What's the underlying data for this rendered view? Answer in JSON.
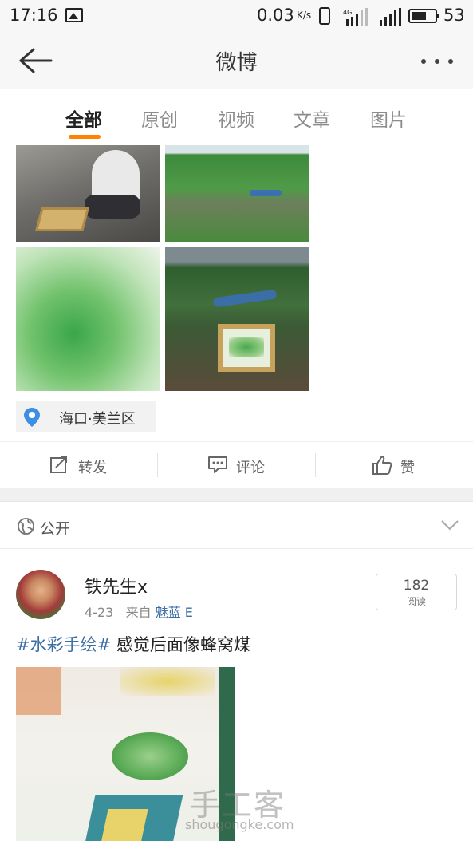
{
  "status_bar": {
    "time": "17:16",
    "speed": "0.03",
    "speed_unit": "K/s",
    "network": "4G",
    "battery": "53"
  },
  "nav": {
    "title": "微博",
    "back_icon": "back-arrow-icon",
    "more_icon": "more-dots-icon"
  },
  "tabs": [
    {
      "label": "全部",
      "active": true
    },
    {
      "label": "原创",
      "active": false
    },
    {
      "label": "视频",
      "active": false
    },
    {
      "label": "文章",
      "active": false
    },
    {
      "label": "图片",
      "active": false
    }
  ],
  "accent_color": "#ff8200",
  "link_color": "#3a6ea5",
  "post1": {
    "location": "海口·美兰区",
    "actions": {
      "repost": "转发",
      "comment": "评论",
      "like": "赞"
    }
  },
  "visibility": {
    "label": "公开"
  },
  "post2": {
    "username": "铁先生x",
    "date": "4-23",
    "from_prefix": "来自",
    "source": "魅蓝 E",
    "reads_count": "182",
    "reads_label": "阅读",
    "hashtag": "#水彩手绘#",
    "text": " 感觉后面像蜂窝煤"
  },
  "watermark": {
    "main": "手工客",
    "sub": "shougongke.com"
  }
}
